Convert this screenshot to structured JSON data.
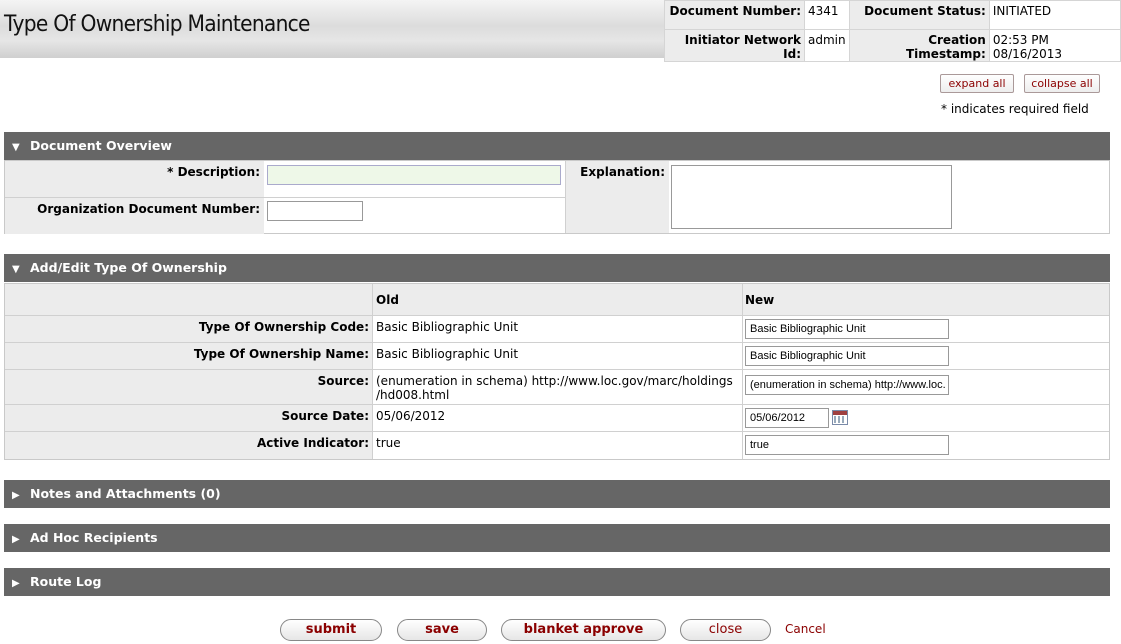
{
  "header": {
    "title": "Type Of Ownership Maintenance",
    "document_number_label": "Document Number:",
    "document_number": "4341",
    "document_status_label": "Document Status:",
    "document_status": "INITIATED",
    "initiator_label": "Initiator Network Id:",
    "initiator": "admin",
    "creation_label": "Creation Timestamp:",
    "creation": "02:53 PM 08/16/2013"
  },
  "controls": {
    "expand_all": "expand all",
    "collapse_all": "collapse all",
    "required_note": "* indicates required field"
  },
  "overview": {
    "title": "Document Overview",
    "description_label": "* Description:",
    "description_value": "",
    "org_doc_label": "Organization Document Number:",
    "org_doc_value": "",
    "explanation_label": "Explanation:",
    "explanation_value": ""
  },
  "edit": {
    "title": "Add/Edit Type Of Ownership",
    "old_header": "Old",
    "new_header": "New",
    "rows": [
      {
        "label": "Type Of Ownership Code:",
        "old": "Basic Bibliographic Unit",
        "new": "Basic Bibliographic Unit"
      },
      {
        "label": "Type Of Ownership Name:",
        "old": "Basic Bibliographic Unit",
        "new": "Basic Bibliographic Unit"
      },
      {
        "label": "Source:",
        "old": "(enumeration in schema) http://www.loc.gov/marc/holdings",
        "old2": "/hd008.html",
        "new": "(enumeration in schema) http://www.loc."
      },
      {
        "label": "Source Date:",
        "old": "05/06/2012",
        "new": "05/06/2012"
      },
      {
        "label": "Active Indicator:",
        "old": "true",
        "new": "true"
      }
    ]
  },
  "sections": {
    "notes": "Notes and Attachments (0)",
    "adhoc": "Ad Hoc Recipients",
    "route": "Route Log"
  },
  "buttons": {
    "submit": "submit",
    "save": "save",
    "blanket_approve": "blanket approve",
    "close": "close",
    "cancel": "Cancel"
  },
  "colors": {
    "section_bar": "#666666",
    "label_bg": "#ececec",
    "button_text": "#8b0000",
    "required_input_bg": "#eef8e8"
  }
}
